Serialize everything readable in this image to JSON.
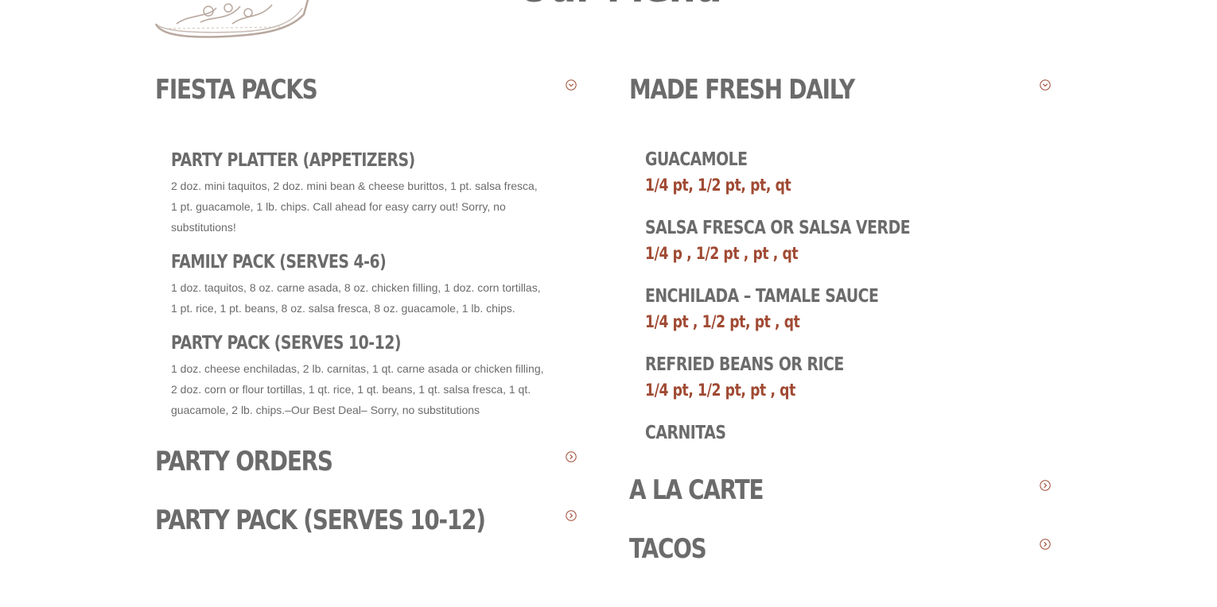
{
  "page": {
    "title": "Our Menu"
  },
  "left": {
    "fiesta": {
      "title": "FIESTA PACKS",
      "icon": "chevron-down-circle-icon",
      "items": [
        {
          "title": "PARTY PLATTER (APPETIZERS)",
          "desc": "2 doz. mini taquitos, 2 doz. mini bean & cheese burittos, 1 pt. salsa fresca, 1 pt. guacamole, 1 lb. chips. Call ahead for easy carry out! Sorry, no substitutions!"
        },
        {
          "title": "FAMILY PACK (SERVES 4-6)",
          "desc": "1 doz. taquitos, 8 oz. carne asada, 8 oz. chicken filling, 1 doz. corn tortillas, 1 pt. rice, 1 pt. beans, 8 oz. salsa fresca, 8 oz. guacamole, 1 lb. chips."
        },
        {
          "title": "PARTY PACK (SERVES 10-12)",
          "desc": "1 doz. cheese enchiladas, 2 lb. carnitas, 1 qt. carne asada or chicken filling, 2 doz. corn or flour tortillas, 1 qt. rice, 1 qt. beans, 1 qt. salsa fresca, 1 qt. guacamole, 2 lb. chips.–Our Best Deal– Sorry, no substitutions"
        }
      ]
    },
    "party_orders": {
      "title": "PARTY ORDERS",
      "icon": "chevron-right-circle-icon"
    },
    "party_pack": {
      "title": "PARTY PACK (SERVES 10-12)",
      "icon": "chevron-right-circle-icon"
    }
  },
  "right": {
    "fresh": {
      "title": "MADE FRESH DAILY",
      "icon": "chevron-down-circle-icon",
      "items": [
        {
          "title": "GUACAMOLE",
          "price": "1/4 pt, 1/2 pt, pt, qt"
        },
        {
          "title": "SALSA FRESCA OR SALSA VERDE",
          "price": "1/4 p , 1/2 pt , pt , qt"
        },
        {
          "title": "ENCHILADA – TAMALE SAUCE",
          "price": "1/4 pt , 1/2 pt, pt , qt"
        },
        {
          "title": "REFRIED BEANS OR RICE",
          "price": "1/4 pt, 1/2 pt, pt , qt"
        },
        {
          "title": "CARNITAS"
        }
      ]
    },
    "a_la_carte": {
      "title": "A LA CARTE",
      "icon": "chevron-right-circle-icon"
    },
    "tacos": {
      "title": "TACOS",
      "icon": "chevron-right-circle-icon"
    }
  },
  "colors": {
    "text": "#6b6b6b",
    "accent": "#a04a33",
    "sketch": "#b8a89f"
  }
}
